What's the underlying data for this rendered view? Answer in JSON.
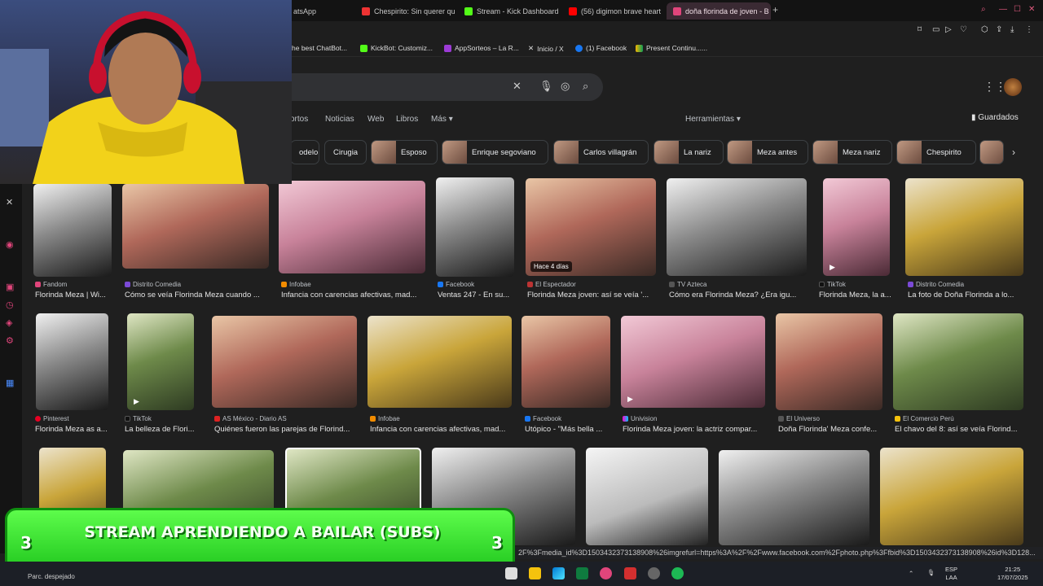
{
  "tabs": [
    {
      "label": "atsApp"
    },
    {
      "label": "Chespirito: Sin querer qu"
    },
    {
      "label": "Stream - Kick Dashboard"
    },
    {
      "label": "(56) digimon brave heart"
    },
    {
      "label": "doña florinda de joven - B"
    }
  ],
  "bookmarks": [
    {
      "label": "he best ChatBot..."
    },
    {
      "label": "KickBot: Customiz..."
    },
    {
      "label": "AppSorteos – La R..."
    },
    {
      "label": "Inicio / X"
    },
    {
      "label": "(1) Facebook"
    },
    {
      "label": "Present Continu......"
    }
  ],
  "nav_tabs": [
    "ortos",
    "Noticias",
    "Web",
    "Libros",
    "Más"
  ],
  "tools_label": "Herramientas",
  "saved_label": "Guardados",
  "chips": [
    {
      "label": "odelo"
    },
    {
      "label": "Cirugia"
    },
    {
      "label": "Esposo"
    },
    {
      "label": "Enrique segoviano"
    },
    {
      "label": "Carlos villagrán"
    },
    {
      "label": "La nariz"
    },
    {
      "label": "Meza antes"
    },
    {
      "label": "Meza nariz"
    },
    {
      "label": "Chespirito"
    }
  ],
  "results": [
    {
      "source": "Fandom",
      "caption": "Florinda Meza | Wi..."
    },
    {
      "source": "Distrito Comedia",
      "caption": "Cómo se veía Florinda Meza cuando ..."
    },
    {
      "source": "Infobae",
      "caption": "Infancia con carencias afectivas, mad..."
    },
    {
      "source": "Facebook",
      "caption": "Ventas 247 - En su...",
      "badge": "Hace 4 días"
    },
    {
      "source": "El Espectador",
      "caption": "Florinda Meza joven: así se veía '..."
    },
    {
      "source": "TV Azteca",
      "caption": "Cómo era Florinda Meza? ¿Era igu..."
    },
    {
      "source": "TikTok",
      "caption": "Florinda Meza, la a..."
    },
    {
      "source": "Distrito Comedia",
      "caption": "La foto de Doña Florinda a lo..."
    },
    {
      "source": "Pinterest",
      "caption": "Florinda Meza as a..."
    },
    {
      "source": "TikTok",
      "caption": "La belleza de Flori..."
    },
    {
      "source": "AS México - Diario AS",
      "caption": "Quiénes fueron las parejas de Florind..."
    },
    {
      "source": "Infobae",
      "caption": "Infancia con carencias afectivas, mad..."
    },
    {
      "source": "Facebook",
      "caption": "Utópico - \"Más bella ..."
    },
    {
      "source": "Univision",
      "caption": "Florinda Meza joven: la actriz compar..."
    },
    {
      "source": "El Universo",
      "caption": "Doña Florinda' Meza confe..."
    },
    {
      "source": "El Comercio Perú",
      "caption": "El chavo del 8: así se veía Florind..."
    }
  ],
  "banner": {
    "text": "STREAM APRENDIENDO A BAILAR (SUBS)",
    "left_num": "3",
    "right_num": "3"
  },
  "status_url": "2F%3Fmedia_id%3D1503432373138908%26imgrefurl=https%3A%2F%2Fwww.facebook.com%2Fphoto.php%3Ffbid%3D1503432373138908%26id%3D128...",
  "taskbar": {
    "weather": "Parc. despejado",
    "lang": "ESP",
    "layout": "LAA",
    "time": "21:25",
    "date": "17/07/2025"
  },
  "colors": {
    "tab_active": "#3a2a33",
    "banner": "#2ee02b",
    "page_bg": "#1f1f1f"
  }
}
